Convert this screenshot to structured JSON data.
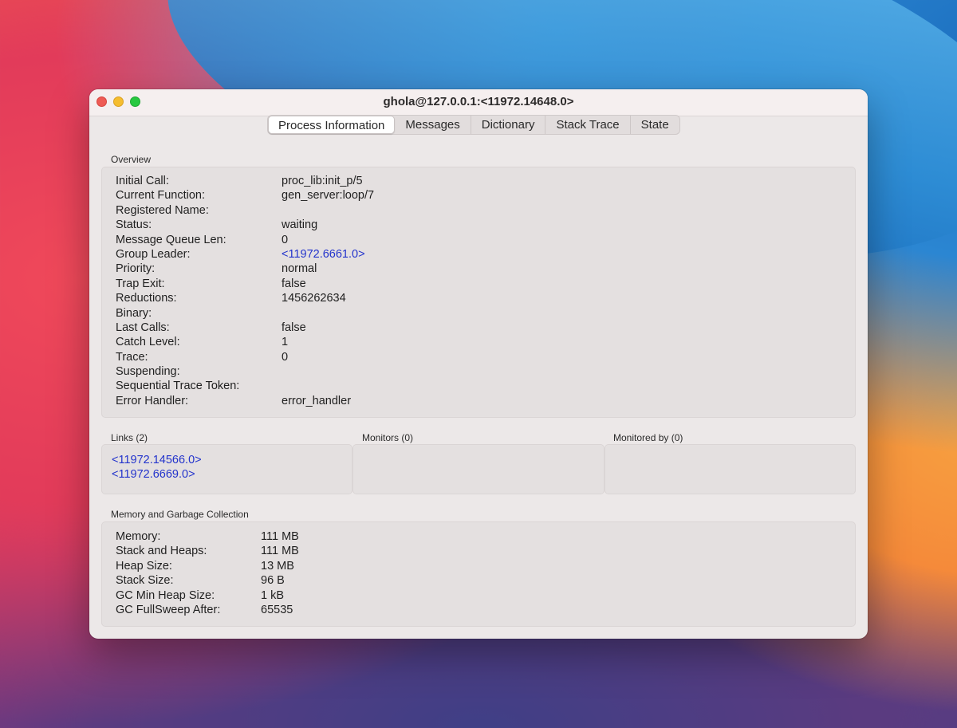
{
  "window": {
    "title": "ghola@127.0.0.1:<11972.14648.0>"
  },
  "tabs": [
    {
      "label": "Process Information",
      "active": true
    },
    {
      "label": "Messages",
      "active": false
    },
    {
      "label": "Dictionary",
      "active": false
    },
    {
      "label": "Stack Trace",
      "active": false
    },
    {
      "label": "State",
      "active": false
    }
  ],
  "overview": {
    "label": "Overview",
    "rows": [
      {
        "key": "Initial Call:",
        "value": "proc_lib:init_p/5"
      },
      {
        "key": "Current Function:",
        "value": "gen_server:loop/7"
      },
      {
        "key": "Registered Name:",
        "value": ""
      },
      {
        "key": "Status:",
        "value": "waiting"
      },
      {
        "key": "Message Queue Len:",
        "value": "0"
      },
      {
        "key": "Group Leader:",
        "value": "<11972.6661.0>",
        "link": true
      },
      {
        "key": "Priority:",
        "value": "normal"
      },
      {
        "key": "Trap Exit:",
        "value": "false"
      },
      {
        "key": "Reductions:",
        "value": "1456262634"
      },
      {
        "key": "Binary:",
        "value": ""
      },
      {
        "key": "Last Calls:",
        "value": "false"
      },
      {
        "key": "Catch Level:",
        "value": "1"
      },
      {
        "key": "Trace:",
        "value": "0"
      },
      {
        "key": "Suspending:",
        "value": ""
      },
      {
        "key": "Sequential Trace Token:",
        "value": ""
      },
      {
        "key": "Error Handler:",
        "value": "error_handler"
      }
    ]
  },
  "links": {
    "label": "Links (2)",
    "items": [
      "<11972.14566.0>",
      "<11972.6669.0>"
    ]
  },
  "monitors": {
    "label": "Monitors (0)"
  },
  "monitored_by": {
    "label": "Monitored by (0)"
  },
  "memory": {
    "label": "Memory and Garbage Collection",
    "rows": [
      {
        "key": "Memory:",
        "value": "111 MB"
      },
      {
        "key": "Stack and Heaps:",
        "value": "111 MB"
      },
      {
        "key": "Heap Size:",
        "value": "13 MB"
      },
      {
        "key": "Stack Size:",
        "value": "96 B"
      },
      {
        "key": "GC Min Heap Size:",
        "value": "1 kB"
      },
      {
        "key": "GC FullSweep After:",
        "value": "65535"
      }
    ]
  },
  "colors": {
    "link": "#2233cc",
    "close": "#ee5b55",
    "minimize": "#f5bd2f",
    "maximize": "#27c840"
  }
}
